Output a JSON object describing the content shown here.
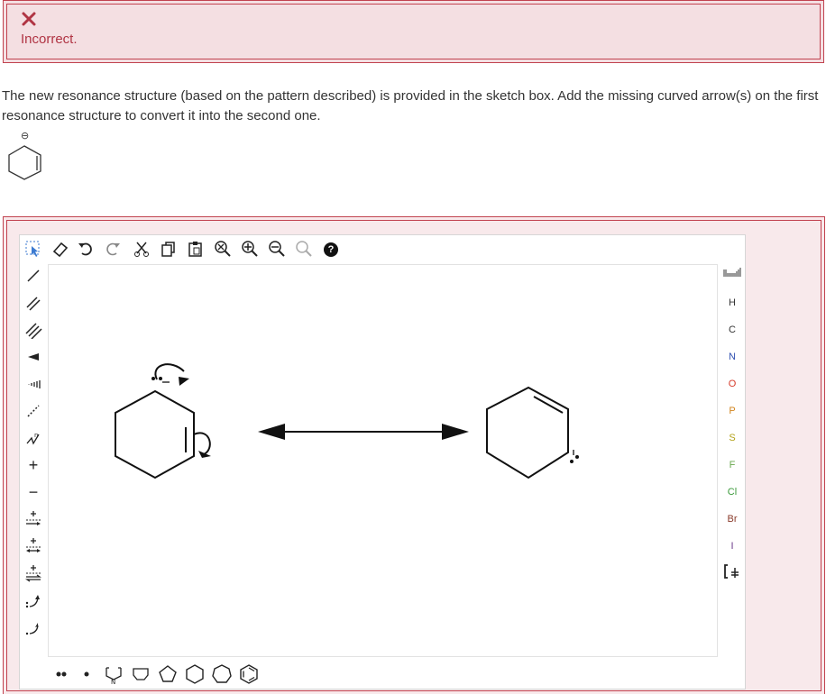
{
  "alert": {
    "status_icon": "x-icon",
    "text": "Incorrect."
  },
  "question": {
    "prompt": "The new resonance structure (based on the pattern described) is provided in the sketch box. Add the missing curved arrow(s) on the first resonance structure to convert it into the second one.",
    "given_structure": {
      "name": "cyclohexenyl anion",
      "charge_label": "⊖"
    }
  },
  "editor": {
    "top_toolbar": [
      {
        "icon": "select-lasso-icon"
      },
      {
        "icon": "eraser-icon"
      },
      {
        "icon": "undo-icon"
      },
      {
        "icon": "redo-icon"
      },
      {
        "icon": "cut-icon"
      },
      {
        "icon": "copy-icon"
      },
      {
        "icon": "paste-icon"
      },
      {
        "icon": "zoom-reset-icon"
      },
      {
        "icon": "zoom-in-icon"
      },
      {
        "icon": "zoom-out-icon"
      },
      {
        "icon": "clean-structure-icon"
      },
      {
        "icon": "help-icon",
        "label": "?"
      }
    ],
    "left_toolbar": [
      {
        "icon": "single-bond-icon"
      },
      {
        "icon": "double-bond-icon"
      },
      {
        "icon": "triple-bond-icon"
      },
      {
        "icon": "wedge-bond-icon"
      },
      {
        "icon": "hash-bond-icon"
      },
      {
        "icon": "dashed-bond-icon"
      },
      {
        "icon": "chain-icon"
      },
      {
        "icon": "positive-charge-icon",
        "label": "+"
      },
      {
        "icon": "negative-charge-icon",
        "label": "−"
      },
      {
        "icon": "reaction-arrow-icon"
      },
      {
        "icon": "resonance-arrow-icon"
      },
      {
        "icon": "equilibrium-arrow-icon"
      },
      {
        "icon": "curved-arrow-double-icon"
      },
      {
        "icon": "curved-arrow-single-icon"
      }
    ],
    "elements": [
      "H",
      "C",
      "N",
      "O",
      "P",
      "S",
      "F",
      "Cl",
      "Br",
      "I"
    ],
    "element_colors": {
      "H": "#333333",
      "C": "#333333",
      "N": "#2f4fb0",
      "O": "#d63a2a",
      "P": "#d2851f",
      "S": "#b3a21b",
      "F": "#6aa84f",
      "Cl": "#3a9a3a",
      "Br": "#8a3b2b",
      "I": "#6b3a8a"
    },
    "right_extra_icons": [
      "periodic-table-icon",
      "bracket-icon"
    ],
    "bottom_toolbar": [
      {
        "icon": "lone-pair-icon"
      },
      {
        "icon": "radical-icon"
      },
      {
        "icon": "template-ring-icon"
      },
      {
        "icon": "cyclobutane-icon"
      },
      {
        "icon": "cyclopentane-icon"
      },
      {
        "icon": "cyclohexane-icon"
      },
      {
        "icon": "cycloheptane-icon"
      },
      {
        "icon": "benzene-icon"
      }
    ],
    "bottom_template_label": "N",
    "canvas": {
      "left_structure": "cyclohexenyl anion with curved arrows",
      "right_structure": "cyclohexene with lone pair",
      "resonance_arrow": "double-headed arrow"
    }
  }
}
